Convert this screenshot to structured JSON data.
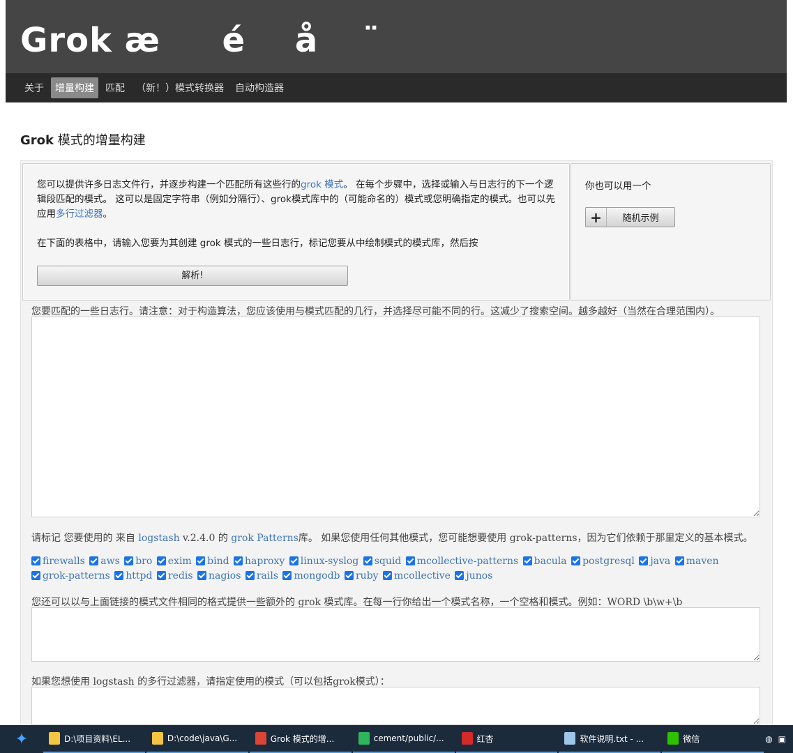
{
  "header": {
    "site_title": "Grok æ     é    å     ̈"
  },
  "nav": {
    "items": [
      "关于",
      "增量构建",
      "匹配",
      "（新！）模式转换器",
      "自动构造器"
    ],
    "active_index": 1
  },
  "page": {
    "title_bold": "Grok",
    "title_rest": " 模式的增量构建"
  },
  "intro": {
    "p1_before": "您可以提供许多日志文件行，并逐步构建一个匹配所有这些行的",
    "p1_link1": "grok 模式",
    "p1_after": "。 在每个步骤中，选择或输入与日志行的下一个逻辑段匹配的模式。 这可以是固定字符串（例如分隔行）、grok模式库中的（可能命名的）模式或您明确指定的模式。也可以先应用",
    "p1_link2": "多行过滤器",
    "p1_end": "。",
    "p2": "在下面的表格中，请输入您要为其创建 grok 模式的一些日志行，标记您要从中绘制模式的模式库，然后按",
    "parse_button": "解析!"
  },
  "side": {
    "text": "你也可以用一个",
    "random_button": "随机示例",
    "plus_icon": "+"
  },
  "log_lines": {
    "label": "您要匹配的一些日志行。请注意：对于构造算法，您应该使用与模式匹配的几行，并选择尽可能不同的行。这减少了搜索空间。越多越好（当然在合理范围内）。",
    "value": ""
  },
  "libraries": {
    "label_before": "请标记 您要使用的 来自 ",
    "label_link1": "logstash",
    "label_mid": " v.2.4.0 的 ",
    "label_link2": "grok Patterns",
    "label_after": "库。 如果您使用任何其他模式，您可能想要使用 grok-patterns，因为它们依赖于那里定义的基本模式。",
    "items": [
      "firewalls",
      "aws",
      "bro",
      "exim",
      "bind",
      "haproxy",
      "linux-syslog",
      "squid",
      "mcollective-patterns",
      "bacula",
      "postgresql",
      "java",
      "maven",
      "grok-patterns",
      "httpd",
      "redis",
      "nagios",
      "rails",
      "mongodb",
      "ruby",
      "mcollective",
      "junos"
    ]
  },
  "extra_patterns": {
    "label": "您还可以以与上面链接的模式文件相同的格式提供一些额外的 grok 模式库。在每一行你给出一个模式名称，一个空格和模式。例如：WORD \\b\\w+\\b",
    "value": ""
  },
  "multiline": {
    "label": "如果您想使用 logstash 的多行过滤器，请指定使用的模式（可以包括grok模式）：",
    "value": ""
  },
  "taskbar": {
    "items": [
      {
        "label": "D:\\项目资料\\EL...",
        "icon": "folder-icon",
        "color": "#f4c542"
      },
      {
        "label": "D:\\code\\java\\G...",
        "icon": "folder-icon",
        "color": "#f4c542"
      },
      {
        "label": "Grok 模式的增...",
        "icon": "chrome-icon",
        "color": "#db4437"
      },
      {
        "label": "cement/public/...",
        "icon": "hbuilder-icon",
        "color": "#2fb55b"
      },
      {
        "label": "红杏",
        "icon": "maple-leaf-icon",
        "color": "#d42a2a"
      },
      {
        "label": "软件说明.txt - ...",
        "icon": "notepad-icon",
        "color": "#9ec6e8"
      },
      {
        "label": "微信",
        "icon": "wechat-icon",
        "color": "#2dc100"
      }
    ]
  }
}
